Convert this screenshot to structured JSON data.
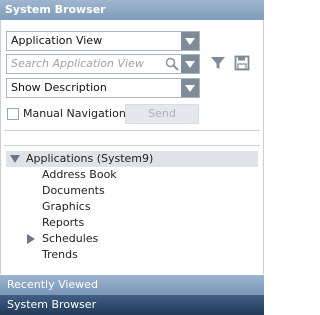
{
  "header": {
    "title": "System Browser"
  },
  "controls": {
    "view_select": "Application View",
    "search_placeholder": "Search Application View",
    "description_select": "Show Description",
    "manual_navigation_label": "Manual Navigation",
    "manual_navigation_checked": false,
    "send_label": "Send"
  },
  "tree": {
    "root_label": "Applications (System9)",
    "items": [
      {
        "label": "Address Book",
        "expandable": false
      },
      {
        "label": "Documents",
        "expandable": false
      },
      {
        "label": "Graphics",
        "expandable": false
      },
      {
        "label": "Reports",
        "expandable": false
      },
      {
        "label": "Schedules",
        "expandable": true
      },
      {
        "label": "Trends",
        "expandable": false
      }
    ]
  },
  "footer": {
    "recently_viewed": "Recently Viewed",
    "system_browser": "System Browser"
  },
  "icons": [
    "search-icon",
    "filter-icon",
    "save-icon",
    "chevron-down-icon",
    "expand-arrow-icon",
    "collapse-arrow-icon"
  ]
}
